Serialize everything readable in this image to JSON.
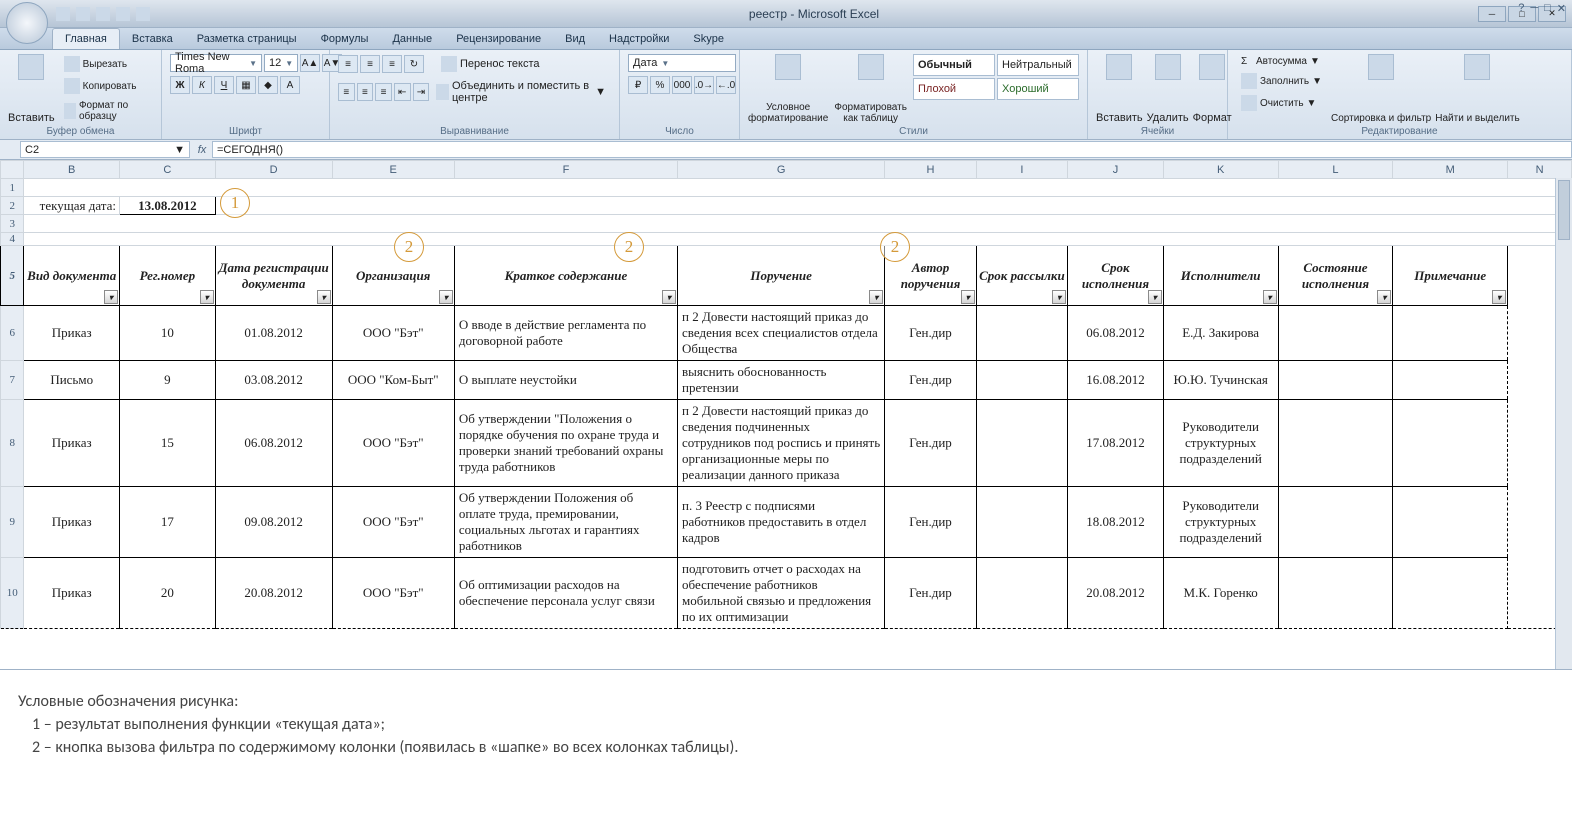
{
  "window": {
    "title": "реестр - Microsoft Excel"
  },
  "qat": {
    "tools": [
      "save",
      "undo",
      "redo",
      "print",
      "more"
    ]
  },
  "tabs": [
    "Главная",
    "Вставка",
    "Разметка страницы",
    "Формулы",
    "Данные",
    "Рецензирование",
    "Вид",
    "Надстройки",
    "Skype"
  ],
  "activeTab": "Главная",
  "ribbon": {
    "clipboard": {
      "label": "Буфер обмена",
      "paste": "Вставить",
      "cut": "Вырезать",
      "copy": "Копировать",
      "formatPainter": "Формат по образцу"
    },
    "font": {
      "label": "Шрифт",
      "family": "Times New Roma",
      "size": "12",
      "bold": "Ж",
      "italic": "К",
      "underline": "Ч"
    },
    "alignment": {
      "label": "Выравнивание",
      "wrap": "Перенос текста",
      "merge": "Объединить и поместить в центре"
    },
    "number": {
      "label": "Число",
      "format": "Дата"
    },
    "styles": {
      "label": "Стили",
      "condfmt": "Условное форматирование",
      "asTable": "Форматировать как таблицу",
      "normal": "Обычный",
      "neutral": "Нейтральный",
      "bad": "Плохой",
      "good": "Хороший"
    },
    "cells": {
      "label": "Ячейки",
      "insert": "Вставить",
      "delete": "Удалить",
      "format": "Формат"
    },
    "editing": {
      "label": "Редактирование",
      "autosum": "Автосумма",
      "fill": "Заполнить",
      "clear": "Очистить",
      "sort": "Сортировка и фильтр",
      "find": "Найти и выделить"
    }
  },
  "nameBox": "C2",
  "formula": "=СЕГОДНЯ()",
  "columns": [
    "",
    "B",
    "C",
    "D",
    "E",
    "F",
    "G",
    "H",
    "I",
    "J",
    "K",
    "L",
    "M",
    "N"
  ],
  "row2": {
    "label": "текущая дата:",
    "value": "13.08.2012"
  },
  "headers": [
    "Вид документа",
    "Рег.номер",
    "Дата регистрации документа",
    "Организация",
    "Краткое содержание",
    "Поручение",
    "Автор поручения",
    "Срок рассылки",
    "Срок исполнения",
    "Исполнители",
    "Состояние исполнения",
    "Примечание"
  ],
  "callouts": {
    "c1": "1",
    "c2": "2"
  },
  "rows": [
    {
      "r": "6",
      "vid": "Приказ",
      "nom": "10",
      "dreg": "01.08.2012",
      "org": "ООО \"Бэт\"",
      "kratkoe": "О вводе в действие регламента по договорной работе",
      "poruch": "п 2 Довести настоящий приказ до сведения всех специалистов отдела Общества",
      "avtor": "Ген.дир",
      "rassylka": "",
      "srok": "06.08.2012",
      "isp": "Е.Д. Закирова",
      "sost": "",
      "prim": ""
    },
    {
      "r": "7",
      "vid": "Письмо",
      "nom": "9",
      "dreg": "03.08.2012",
      "org": "ООО \"Ком-Быт\"",
      "kratkoe": "О выплате неустойки",
      "poruch": "выяснить обоснованность претензии",
      "avtor": "Ген.дир",
      "rassylka": "",
      "srok": "16.08.2012",
      "isp": "Ю.Ю. Тучинская",
      "sost": "",
      "prim": ""
    },
    {
      "r": "8",
      "vid": "Приказ",
      "nom": "15",
      "dreg": "06.08.2012",
      "org": "ООО \"Бэт\"",
      "kratkoe": "Об утверждении \"Положения о порядке обучения по охране труда и проверки знаний требований охраны труда работников",
      "poruch": "п 2 Довести настоящий приказ до сведения подчиненных сотрудников под роспись и принять организационные меры по реализации данного приказа",
      "avtor": "Ген.дир",
      "rassylka": "",
      "srok": "17.08.2012",
      "isp": "Руководители структурных подразделений",
      "sost": "",
      "prim": ""
    },
    {
      "r": "9",
      "vid": "Приказ",
      "nom": "17",
      "dreg": "09.08.2012",
      "org": "ООО \"Бэт\"",
      "kratkoe": "Об утверждении Положения об оплате труда, премировании, социальных льготах и гарантиях работников",
      "poruch": "п. 3 Реестр с подписями работников предоставить в отдел кадров",
      "avtor": "Ген.дир",
      "rassylka": "",
      "srok": "18.08.2012",
      "isp": "Руководители структурных подразделений",
      "sost": "",
      "prim": ""
    },
    {
      "r": "10",
      "vid": "Приказ",
      "nom": "20",
      "dreg": "20.08.2012",
      "org": "ООО \"Бэт\"",
      "kratkoe": "Об оптимизации расходов на обеспечение персонала услуг связи",
      "poruch": "подготовить отчет о расходах на обеспечение работников мобильной связью и предложения по их оптимизации",
      "avtor": "Ген.дир",
      "rassylka": "",
      "srok": "20.08.2012",
      "isp": "М.К. Горенко",
      "sost": "",
      "prim": ""
    }
  ],
  "legend": {
    "title": "Условные обозначения рисунка:",
    "l1": "1 –  результат выполнения функции «текущая дата»;",
    "l2": "2 –  кнопка вызова фильтра по содержимому колонки (появилась в «шапке» во всех колонках таблицы)."
  }
}
